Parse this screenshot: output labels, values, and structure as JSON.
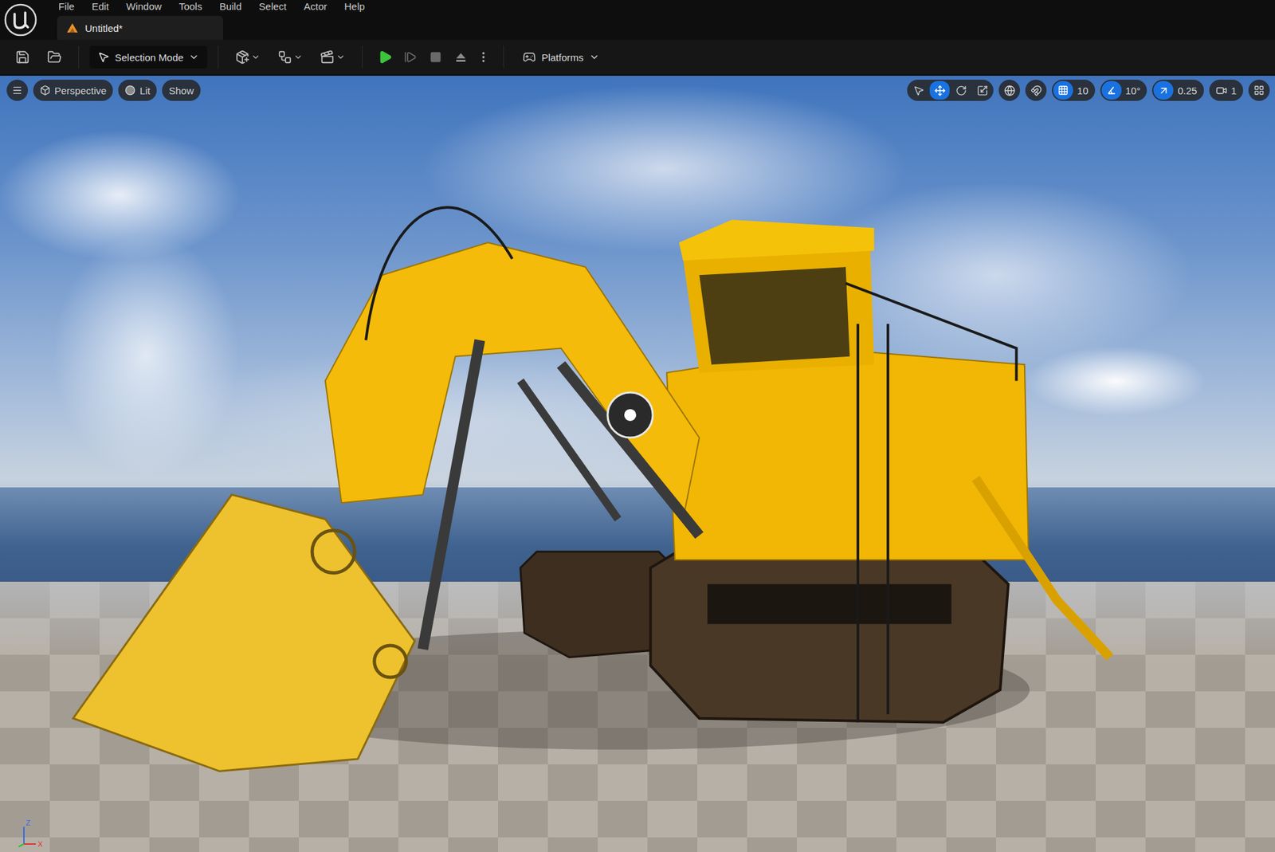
{
  "menu": [
    "File",
    "Edit",
    "Window",
    "Tools",
    "Build",
    "Select",
    "Actor",
    "Help"
  ],
  "tabs": [
    {
      "label": "Untitled*",
      "selected": true
    }
  ],
  "toolbar": {
    "mode_button": "Selection Mode",
    "platforms_button": "Platforms"
  },
  "viewport": {
    "view_mode": "Perspective",
    "lighting": "Lit",
    "show": "Show",
    "transform_tools": [
      {
        "kind": "select",
        "selected": false
      },
      {
        "kind": "translate",
        "selected": true
      },
      {
        "kind": "rotate",
        "selected": false
      },
      {
        "kind": "scale",
        "selected": false
      }
    ],
    "snaps": [
      {
        "kind": "grid",
        "value": "10",
        "on": true
      },
      {
        "kind": "angle",
        "value": "10°",
        "on": true
      },
      {
        "kind": "scale",
        "value": "0.25",
        "on": true
      }
    ],
    "camera_speed": "1",
    "axis_labels": [
      "Z",
      "X"
    ]
  }
}
